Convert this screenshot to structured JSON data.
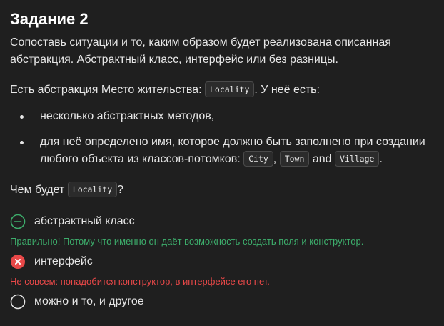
{
  "task": {
    "title": "Задание 2",
    "intro": "Сопоставь ситуации и то, каким образом будет реализована описанная абстракция. Абстрактный класс, интерфейс или без разницы.",
    "abstraction_prefix": "Есть абстракция Место жительства: ",
    "abstraction_code": "Locality",
    "abstraction_suffix": ". У неё есть:",
    "bullets": {
      "first": "несколько абстрактных методов,",
      "second_text": "для неё определено имя, которое должно быть заполнено при создании любого объекта из классов-потомков: ",
      "code_city": "City",
      "comma": ", ",
      "code_town": "Town",
      "and_word": " and ",
      "code_village": "Village",
      "period": "."
    },
    "question_prefix": "Чем будет ",
    "question_code": "Locality",
    "question_suffix": "?"
  },
  "options": [
    {
      "label": "абстрактный класс",
      "state": "correct",
      "icon": "minus-circle-icon",
      "feedback": "Правильно! Потому что именно он даёт возможность создать поля и конструктор."
    },
    {
      "label": "интерфейс",
      "state": "wrong",
      "icon": "x-circle-icon",
      "feedback": "Не совсем: понадобится конструктор, в интерфейсе его нет."
    },
    {
      "label": "можно и то, и другое",
      "state": "unselected",
      "icon": "empty-circle-icon",
      "feedback": ""
    }
  ],
  "colors": {
    "background": "#1f1f1f",
    "text": "#e6e6e6",
    "correct": "#3dae6c",
    "wrong": "#e84848"
  }
}
